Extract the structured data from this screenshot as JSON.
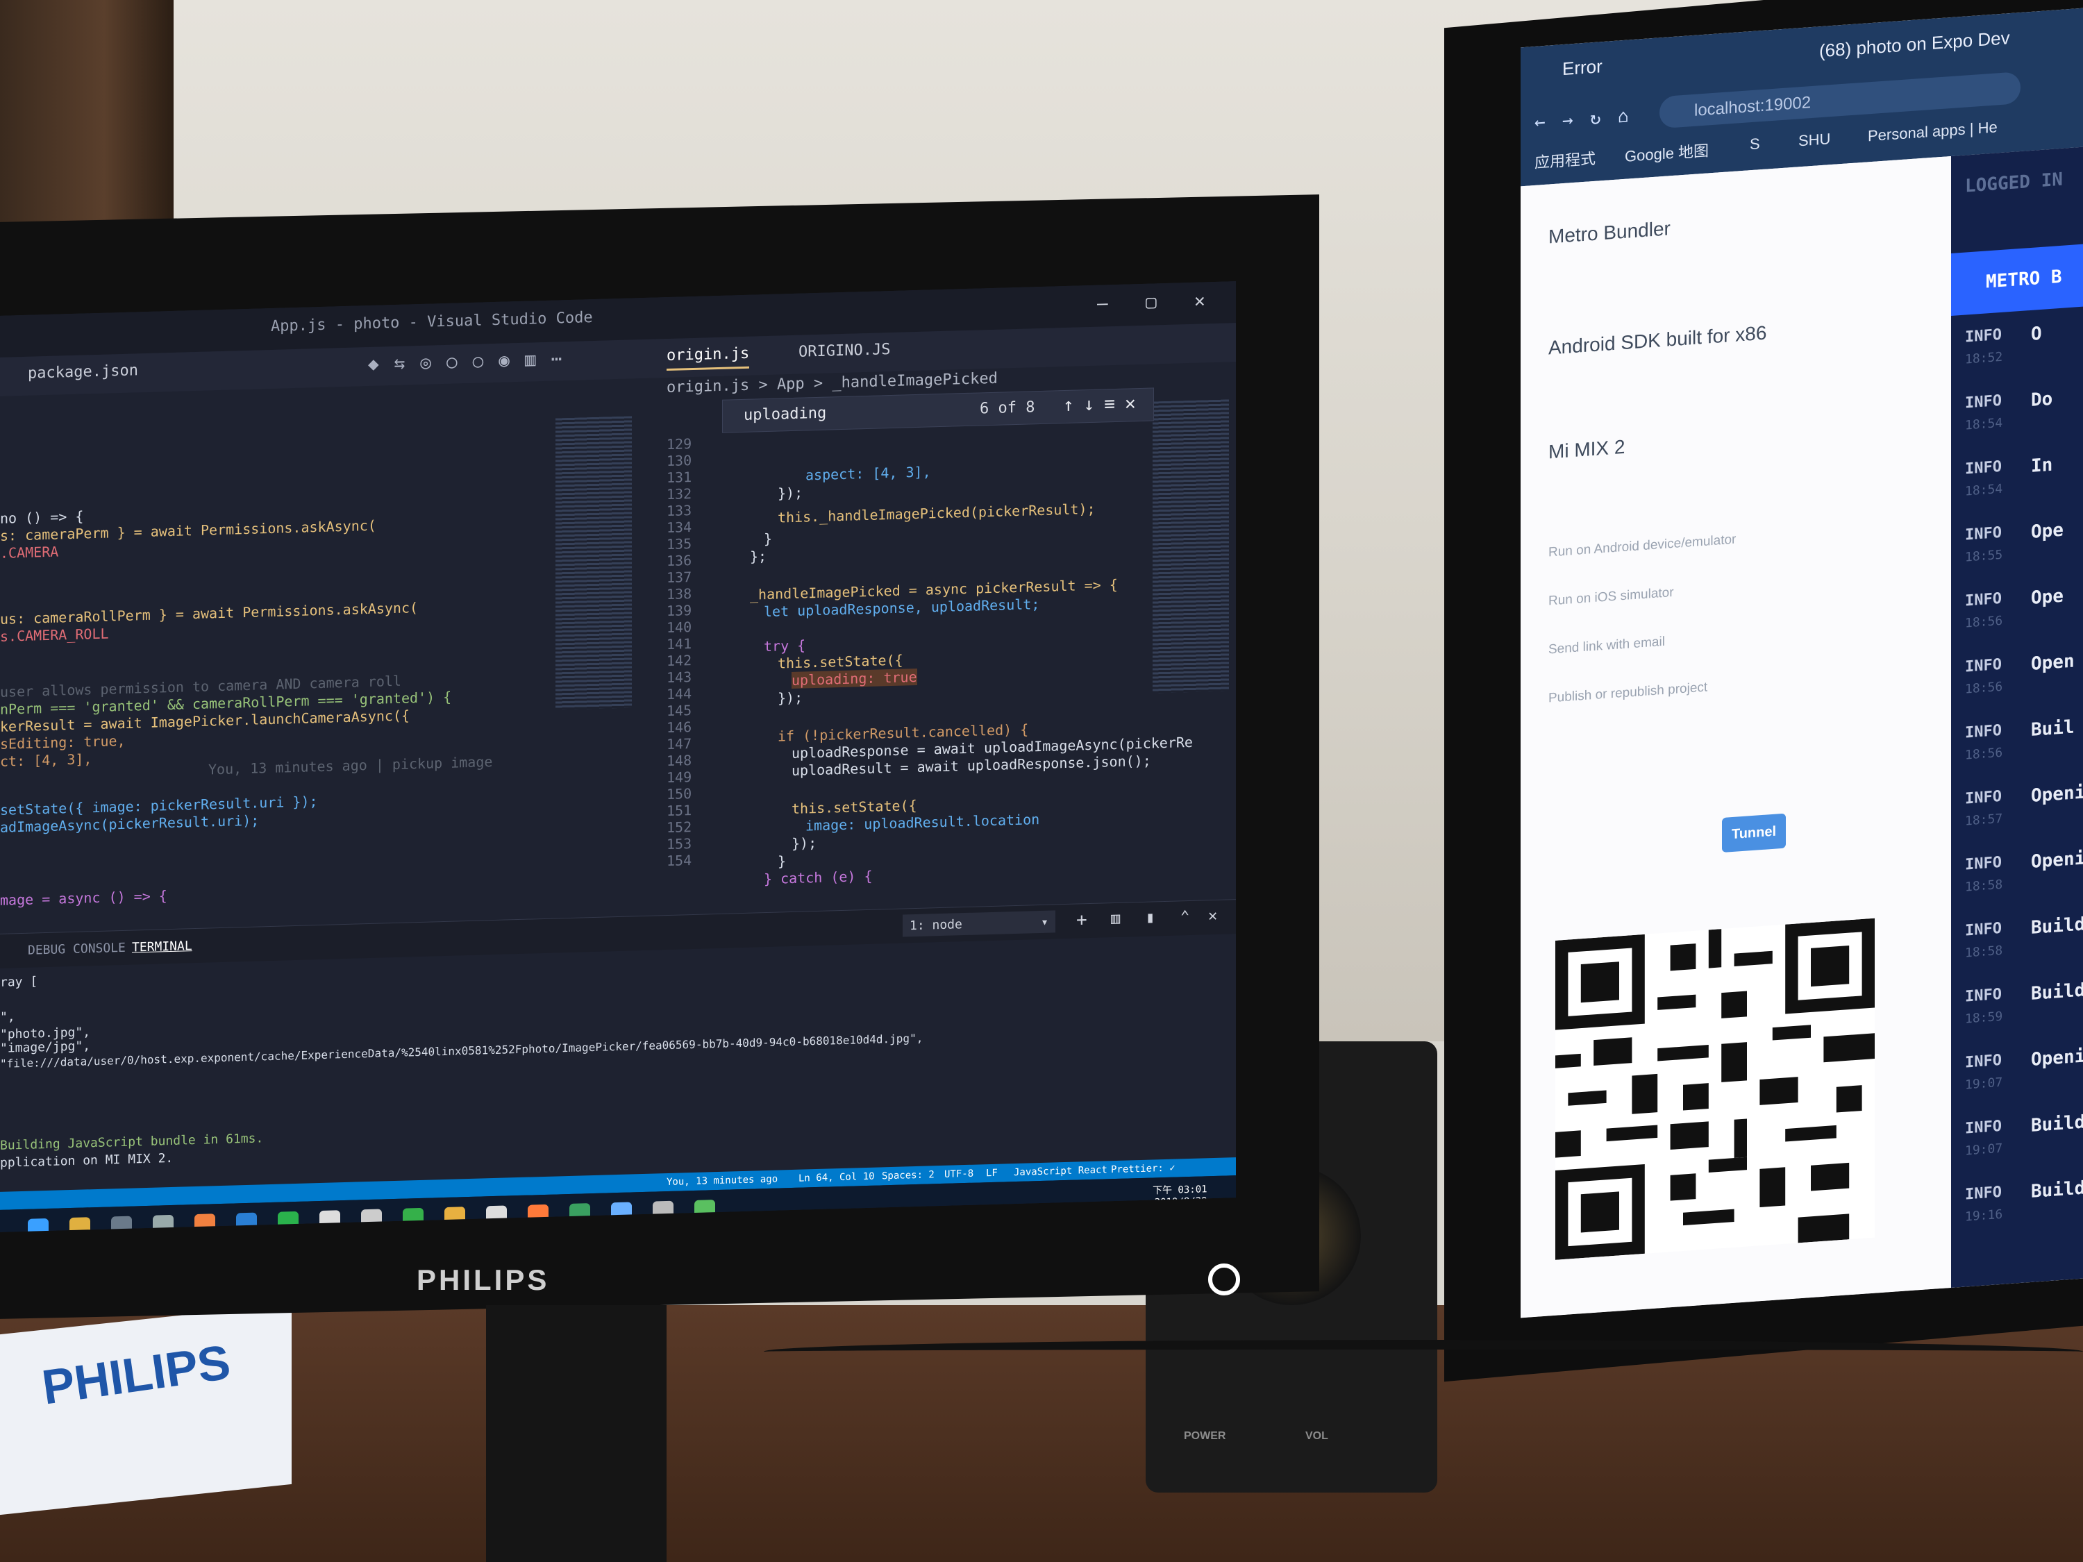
{
  "monitor_main": {
    "brand": "PHILIPS",
    "window_title": "App.js - photo - Visual Studio Code",
    "tabs": [
      "package.json",
      "origin.js",
      "ORIGINO.JS"
    ],
    "breadcrumb": "origin.js > App > _handleImagePicked",
    "find": {
      "query": "uploading",
      "count": "6 of 8"
    },
    "line_numbers": [
      "129",
      "130",
      "131",
      "132",
      "133",
      "134",
      "135",
      "136",
      "137",
      "138",
      "139",
      "140",
      "141",
      "142",
      "143",
      "144",
      "145",
      "146",
      "147",
      "148",
      "149",
      "150",
      "151",
      "152",
      "153",
      "154"
    ],
    "left_code": [
      "no () => {",
      "s: cameraPerm } = await Permissions.askAsync(",
      ".CAMERA",
      "us: cameraRollPerm } = await Permissions.askAsync(",
      "s.CAMERA_ROLL",
      "user allows permission to camera AND camera roll",
      "nPerm === 'granted' && cameraRollPerm === 'granted') {",
      "kerResult = await ImagePicker.launchCameraAsync({",
      "sEditing: true,",
      "ct: [4, 3],",
      "You, 13 minutes ago | pickup image",
      "setState({ image: pickerResult.uri });",
      "adImageAsync(pickerResult.uri);",
      "mage = async () => {"
    ],
    "right_code": [
      "aspect: [4, 3],",
      "});",
      "this._handleImagePicked(pickerResult);",
      "}",
      "};",
      "_handleImagePicked = async pickerResult => {",
      "let uploadResponse, uploadResult;",
      "try {",
      "this.setState({",
      "uploading: true",
      "});",
      "if (!pickerResult.cancelled) {",
      "uploadResponse = await uploadImageAsync(pickerRe",
      "uploadResult = await uploadResponse.json();",
      "this.setState({",
      "image: uploadResult.location",
      "});",
      "}",
      "} catch (e) {"
    ],
    "panel_tabs": [
      "DEBUG CONSOLE",
      "TERMINAL"
    ],
    "terminal_select": "1: node",
    "terminal_lines": [
      "ray [",
      "\",",
      "\"photo.jpg\",",
      "\"image/jpg\",",
      "\"file:///data/user/0/host.exp.exponent/cache/ExperienceData/%2540linx0581%252Fphoto/ImagePicker/fea06569-bb7b-40d9-94c0-b68018e10d4d.jpg\",",
      "Building JavaScript bundle in 61ms.",
      "pplication on MI MIX 2."
    ],
    "status": [
      "You, 13 minutes ago",
      "Ln 64, Col 10",
      "Spaces: 2",
      "UTF-8",
      "LF",
      "JavaScript React",
      "Prettier: ✓"
    ],
    "clock": [
      "下午 03:01",
      "2019/8/29"
    ]
  },
  "monitor_right": {
    "browser_tabs": [
      "Error",
      "(68) photo on Expo Dev"
    ],
    "url": "localhost:19002",
    "bookmarks": [
      "应用程式",
      "Google 地图",
      "S",
      "SHU",
      "Personal apps | He"
    ],
    "devices": [
      "Metro Bundler",
      "Android SDK built for x86",
      "Mi MIX 2"
    ],
    "links": [
      "Run on Android device/emulator",
      "Run on iOS simulator",
      "Send link with email",
      "Publish or republish project"
    ],
    "tunnel_button": "Tunnel",
    "logged_in": "LOGGED IN",
    "metro_label": "METRO B",
    "logs": [
      {
        "level": "INFO",
        "msg": "O"
      },
      {
        "level": "INFO",
        "msg": "Do"
      },
      {
        "level": "INFO",
        "msg": "In"
      },
      {
        "level": "INFO",
        "msg": "Ope"
      },
      {
        "level": "INFO",
        "msg": "Ope"
      },
      {
        "level": "INFO",
        "msg": "Open"
      },
      {
        "level": "INFO",
        "msg": "Buil"
      },
      {
        "level": "INFO",
        "msg": "Openi"
      },
      {
        "level": "INFO",
        "msg": "Openi"
      },
      {
        "level": "INFO",
        "msg": "Buildi"
      },
      {
        "level": "INFO",
        "msg": "Buildi"
      },
      {
        "level": "INFO",
        "msg": "Opening"
      },
      {
        "level": "INFO",
        "msg": "Building"
      },
      {
        "level": "INFO",
        "msg": "Building"
      }
    ],
    "log_times": [
      "18:52",
      "18:54",
      "18:54",
      "18:55",
      "18:56",
      "18:56",
      "18:56",
      "18:57",
      "18:58",
      "18:58",
      "18:59",
      "19:07",
      "19:07",
      "19:16"
    ]
  },
  "colors": {
    "editor_bg": "#1e2230",
    "statusbar": "#007acc",
    "metro_blue": "#2a63ff",
    "log_bg": "#13214a"
  }
}
